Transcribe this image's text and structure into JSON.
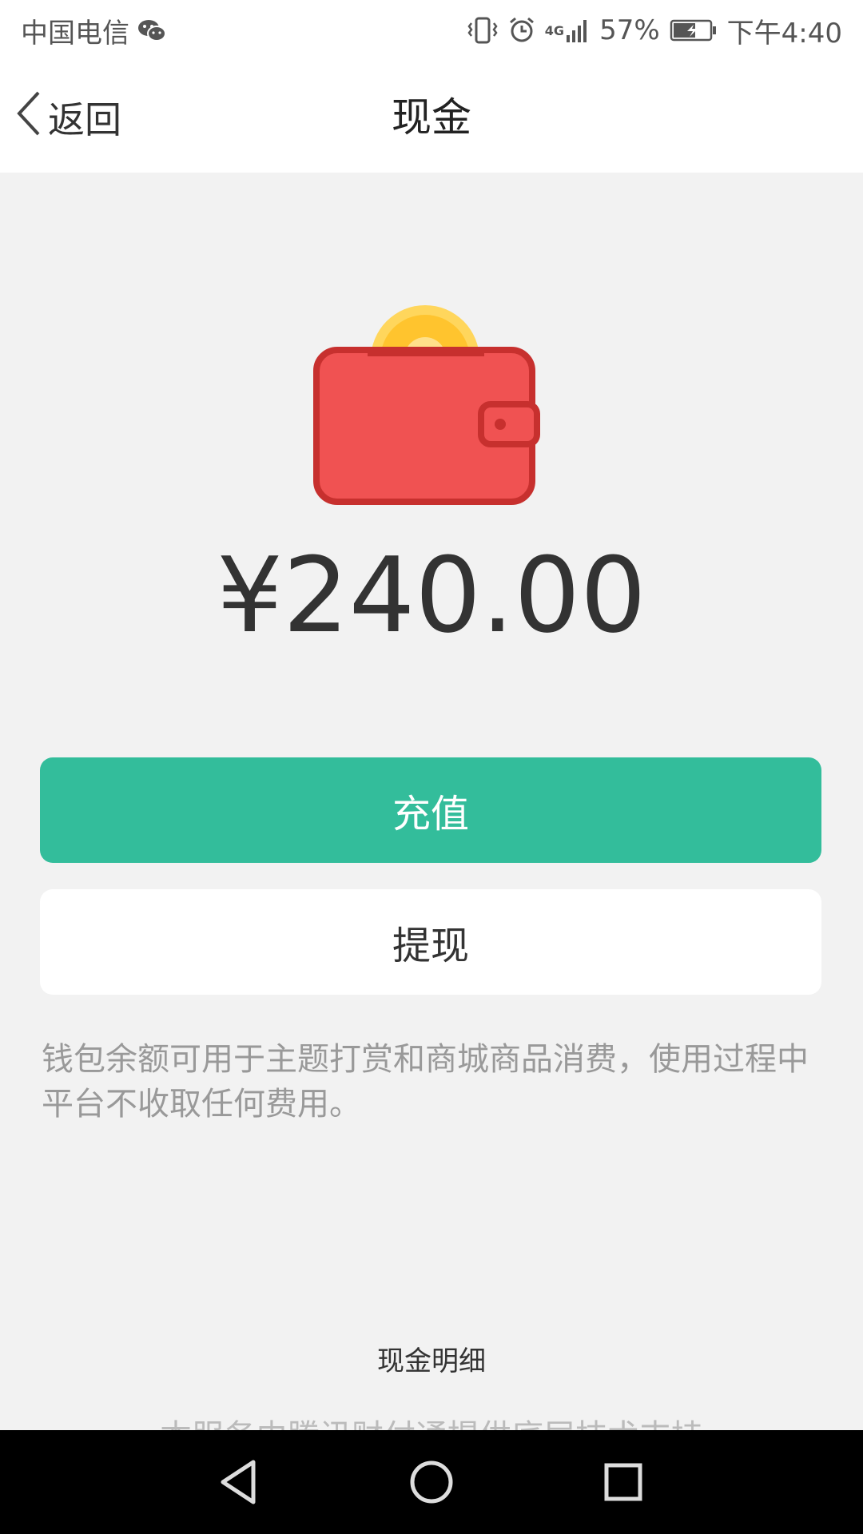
{
  "status_bar": {
    "carrier": "中国电信",
    "network": "4G",
    "battery": "57%",
    "time": "下午4:40"
  },
  "nav": {
    "back_label": "返回",
    "title": "现金"
  },
  "wallet": {
    "balance": "¥240.00"
  },
  "actions": {
    "recharge_label": "充值",
    "withdraw_label": "提现"
  },
  "note": "钱包余额可用于主题打赏和商城商品消费，使用过程中平台不收取任何费用。",
  "detail_link": "现金明细",
  "footer_note": "本服务由腾讯财付通提供底层技术支持",
  "colors": {
    "primary": "#33bd9b",
    "wallet_red": "#f05252",
    "coin_yellow": "#ffc42e"
  }
}
